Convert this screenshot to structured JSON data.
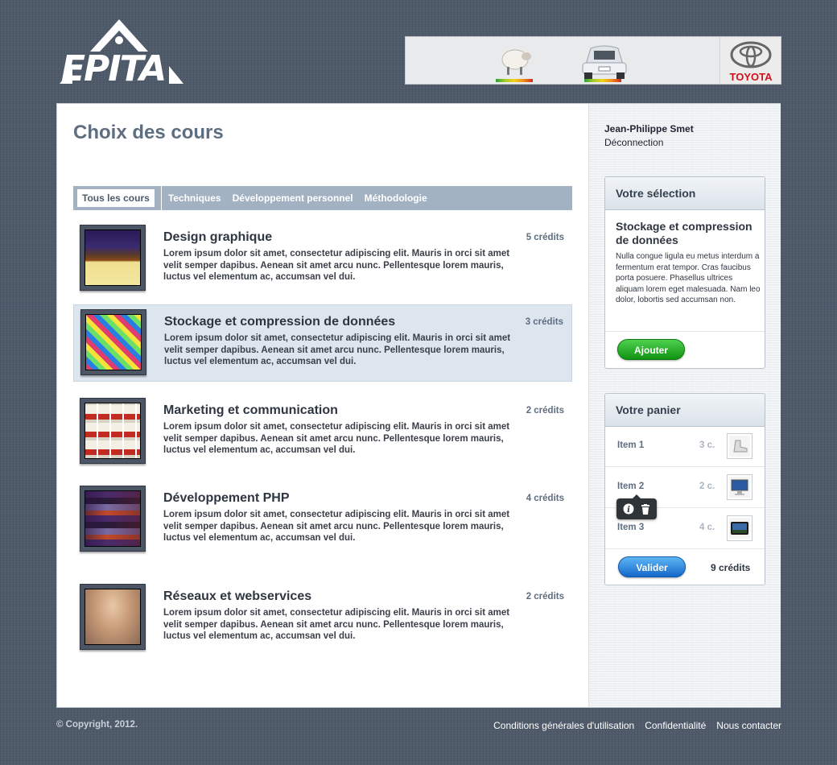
{
  "brand": {
    "logo_text": "EPITA",
    "sponsor": "TOYOTA"
  },
  "page": {
    "title": "Choix des cours"
  },
  "tabs": [
    {
      "label": "Tous les cours",
      "active": true
    },
    {
      "label": "Techniques"
    },
    {
      "label": "Développement personnel"
    },
    {
      "label": "Méthodologie"
    }
  ],
  "courses": [
    {
      "title": "Design graphique",
      "credits": "5 crédits",
      "desc": "Lorem ipsum dolor sit amet, consectetur adipiscing elit. Mauris in orci sit amet velit semper dapibus. Aenean sit amet arcu nunc. Pellentesque lorem mauris, luctus vel elementum ac, accumsan vel dui."
    },
    {
      "title": "Stockage et compression de données",
      "credits": "3 crédits",
      "desc": "Lorem ipsum dolor sit amet, consectetur adipiscing elit. Mauris in orci sit amet velit semper dapibus. Aenean sit amet arcu nunc. Pellentesque lorem mauris, luctus vel elementum ac, accumsan vel dui.",
      "selected": true
    },
    {
      "title": "Marketing et communication",
      "credits": "2 crédits",
      "desc": "Lorem ipsum dolor sit amet, consectetur adipiscing elit. Mauris in orci sit amet velit semper dapibus. Aenean sit amet arcu nunc. Pellentesque lorem mauris, luctus vel elementum ac, accumsan vel dui."
    },
    {
      "title": "Développement PHP",
      "credits": "4 crédits",
      "desc": "Lorem ipsum dolor sit amet, consectetur adipiscing elit. Mauris in orci sit amet velit semper dapibus. Aenean sit amet arcu nunc. Pellentesque lorem mauris, luctus vel elementum ac, accumsan vel dui."
    },
    {
      "title": "Réseaux et webservices",
      "credits": "2 crédits",
      "desc": "Lorem ipsum dolor sit amet, consectetur adipiscing elit. Mauris in orci sit amet velit semper dapibus. Aenean sit amet arcu nunc. Pellentesque lorem mauris, luctus vel elementum ac, accumsan vel dui."
    }
  ],
  "user": {
    "name": "Jean-Philippe Smet",
    "logout_label": "Déconnection"
  },
  "selection": {
    "heading": "Votre sélection",
    "title": "Stockage et compression de données",
    "desc": "Nulla congue ligula eu metus interdum a fermentum erat tempor. Cras faucibus porta posuere. Phasellus ultrices aliquam lorem eget malesuada. Nam leo dolor, lobortis sed accumsan non.",
    "add_label": "Ajouter"
  },
  "cart": {
    "heading": "Votre panier",
    "items": [
      {
        "name": "Item 1",
        "credits": "3 c."
      },
      {
        "name": "Item 2",
        "credits": "2 c."
      },
      {
        "name": "Item 3",
        "credits": "4 c."
      }
    ],
    "validate_label": "Valider",
    "total": "9 crédits"
  },
  "footer": {
    "copyright": "© Copyright, 2012.",
    "links": [
      "Conditions générales d'utilisation",
      "Confidentialité",
      "Nous contacter"
    ]
  },
  "colors": {
    "background": "#4e5a6a",
    "accent": "#5e6e81",
    "tab_bar": "#a3b2c3",
    "selected_row": "#dde6ee",
    "add_button": "#1aa11c",
    "validate_button": "#1f7ad6"
  }
}
